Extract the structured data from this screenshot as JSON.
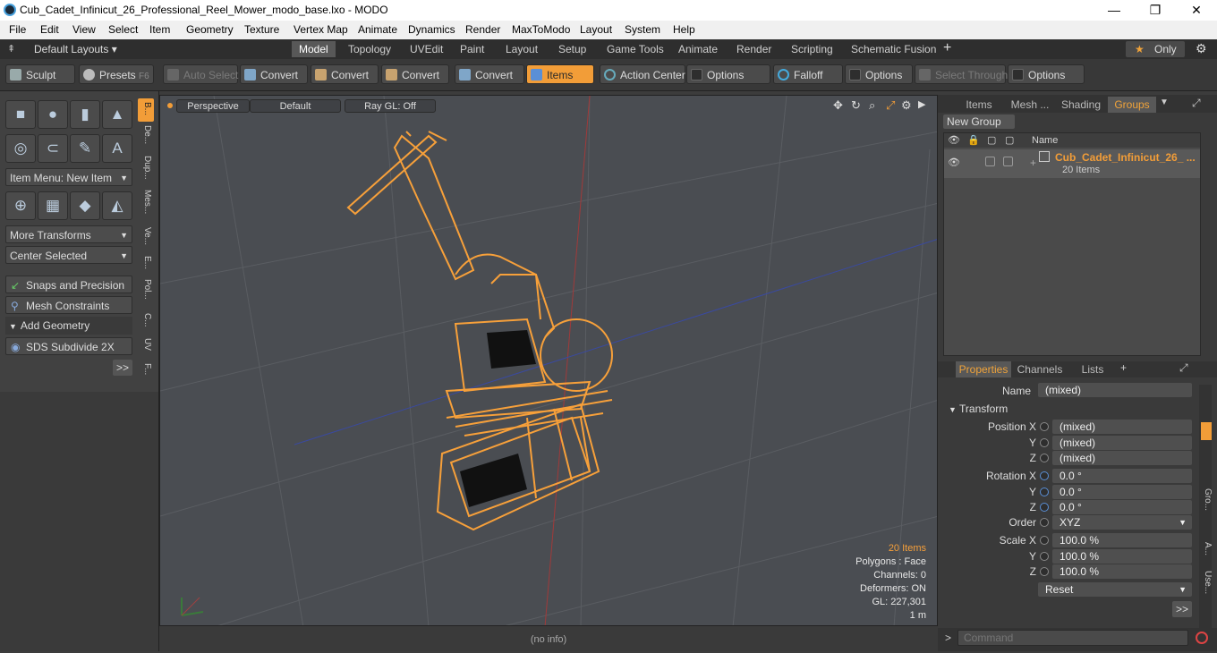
{
  "window": {
    "title": "Cub_Cadet_Infinicut_26_Professional_Reel_Mower_modo_base.lxo - MODO",
    "minimize": "—",
    "maximize": "❐",
    "close": "✕"
  },
  "menu": [
    "File",
    "Edit",
    "View",
    "Select",
    "Item",
    "Geometry",
    "Texture",
    "Vertex Map",
    "Animate",
    "Dynamics",
    "Render",
    "MaxToModo",
    "Layout",
    "System",
    "Help"
  ],
  "layoutbar": {
    "layouts": "Default Layouts ▾",
    "tabs": [
      "Model",
      "Topology",
      "UVEdit",
      "Paint",
      "Layout",
      "Setup",
      "Game Tools",
      "Animate",
      "Render",
      "Scripting",
      "Schematic Fusion"
    ],
    "active_tab": "Model",
    "plus": "+",
    "only": "Only",
    "star": "★"
  },
  "toolbar": {
    "sculpt": "Sculpt",
    "presets": "Presets",
    "presets_key": "F6",
    "auto_select": "Auto Select",
    "convert": "Convert",
    "items": "Items",
    "action_center": "Action Center",
    "options": "Options",
    "falloff": "Falloff",
    "select_through": "Select Through"
  },
  "leftpanel": {
    "item_menu": "Item Menu: New Item",
    "more_transforms": "More Transforms",
    "center_selected": "Center Selected",
    "snaps": "Snaps and Precision",
    "mesh_constraints": "Mesh Constraints",
    "add_geometry": "Add Geometry",
    "sds": "SDS Subdivide 2X",
    "more": ">>",
    "vtabs": [
      "B...",
      "De...",
      "Dup...",
      "Mes...",
      "Ve...",
      "E...",
      "Pol...",
      "C...",
      "UV",
      "F..."
    ]
  },
  "viewport": {
    "view": "Perspective",
    "shading": "Default",
    "raygl": "Ray GL: Off",
    "stats": {
      "items": "20 Items",
      "polygons": "Polygons : Face",
      "channels": "Channels: 0",
      "deformers": "Deformers: ON",
      "gl": "GL: 227,301",
      "scale": "1 m"
    },
    "accent": "#f7a03a"
  },
  "status": "(no info)",
  "groups": {
    "tabs": [
      "Items",
      "Mesh ...",
      "Shading",
      "Groups"
    ],
    "active": "Groups",
    "new_group": "New Group",
    "col_name": "Name",
    "item_name": "Cub_Cadet_Infinicut_26_ ...",
    "item_count": "20 Items"
  },
  "properties": {
    "tabs": [
      "Properties",
      "Channels",
      "Lists"
    ],
    "active": "Properties",
    "plus": "+",
    "name_label": "Name",
    "name_value": "(mixed)",
    "transform": "Transform",
    "position_label": "Position X",
    "rotation_label": "Rotation X",
    "scale_label": "Scale X",
    "y": "Y",
    "z": "Z",
    "pos": [
      "(mixed)",
      "(mixed)",
      "(mixed)"
    ],
    "rot": [
      "0.0 °",
      "0.0 °",
      "0.0 °"
    ],
    "scl": [
      "100.0 %",
      "100.0 %",
      "100.0 %"
    ],
    "order_label": "Order",
    "order_value": "XYZ",
    "reset": "Reset",
    "more": ">>",
    "side_tabs": [
      "Gro...",
      "A...",
      "Use..."
    ]
  },
  "command": {
    "prompt": ">",
    "placeholder": "Command"
  }
}
